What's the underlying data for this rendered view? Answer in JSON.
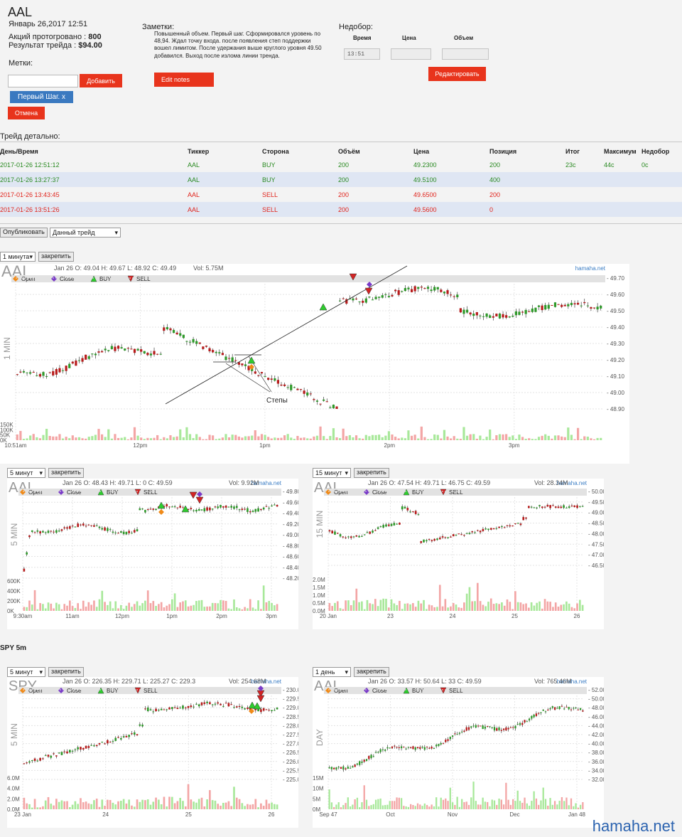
{
  "header": {
    "ticker": "AAL",
    "date": "Январь 26,2017 12:51",
    "shares_label": "Акций протогровано : ",
    "shares_value": "800",
    "result_label": "Результат трейда : ",
    "result_value": "$94.00"
  },
  "tags": {
    "label": "Метки:",
    "input_value": "",
    "add_button": "Добавить",
    "chip": "Первый Шаг.",
    "chip_close": "x",
    "cancel_button": "Отмена"
  },
  "notes": {
    "label": "Заметки:",
    "text": "Повышенный объем. Первый шаг. Сформировался уровень по 48,94. Ждал точку входа. после появления степ поддержки вошел лимитом. После удержания выше круглого уровня 49.50 добавился. Выход после излома линии тренда.",
    "button": "Edit notes"
  },
  "shortfall": {
    "label": "Недобор:",
    "col_time": "Время",
    "col_price": "Цена",
    "col_volume": "Объем",
    "time_value": "13:51",
    "price_value": "",
    "volume_value": "",
    "button": "Редактировать"
  },
  "details": {
    "label": "Трейд детально:",
    "columns": [
      "День/Время",
      "Тиккер",
      "Сторона",
      "Объём",
      "Цена",
      "Позиция",
      "Итог",
      "Максимум",
      "Недобор"
    ],
    "rows": [
      {
        "cells": [
          "2017-01-26 12:51:12",
          "AAL",
          "BUY",
          "200",
          "49.2300",
          "200",
          "23c",
          "44c",
          "0c"
        ],
        "side": "buy"
      },
      {
        "cells": [
          "2017-01-26 13:27:37",
          "AAL",
          "BUY",
          "200",
          "49.5100",
          "400",
          "",
          "",
          ""
        ],
        "side": "buy"
      },
      {
        "cells": [
          "2017-01-26 13:43:45",
          "AAL",
          "SELL",
          "200",
          "49.6500",
          "200",
          "",
          "",
          ""
        ],
        "side": "sell"
      },
      {
        "cells": [
          "2017-01-26 13:51:26",
          "AAL",
          "SELL",
          "200",
          "49.5600",
          "0",
          "",
          "",
          ""
        ],
        "side": "sell"
      }
    ]
  },
  "publish": {
    "button": "Опубликовать",
    "select": "Данный трейд"
  },
  "legend": {
    "open": "Open",
    "close": "Close",
    "buy": "BUY",
    "sell": "SELL"
  },
  "colors": {
    "up": "#2f9a2a",
    "down": "#b81c1c",
    "vol_up": "#a8e89a",
    "vol_down": "#f3a5a5",
    "open_marker": "#f08a18",
    "close_marker": "#7a3bc8",
    "buy_marker": "#2ecc2e",
    "sell_marker": "#d22424"
  },
  "spy_label": "SPY 5m",
  "charts": [
    {
      "id": "c1",
      "select": "1 минута",
      "pin": "закрепить",
      "symbol": "AAL",
      "side_label": "1 MIN",
      "brand": "hamaha.net",
      "ohlc": "Jan 26 O: 49.04 H: 49.67 L: 48.92 C: 49.49",
      "vol": "Vol: 5.75M",
      "yticks": [
        "49.70",
        "49.60",
        "49.50",
        "49.40",
        "49.30",
        "49.20",
        "49.10",
        "49.00",
        "48.90"
      ],
      "vticks": [
        "150K",
        "100K",
        "50K",
        "0K"
      ],
      "xticks": [
        "10:51am",
        "12pm",
        "1pm",
        "2pm",
        "3pm"
      ],
      "annotation": "Степы"
    },
    {
      "id": "c2",
      "select": "5 минут",
      "pin": "закрепить",
      "symbol": "AAL",
      "side_label": "5 MIN",
      "brand": "hamaha.net",
      "ohlc": "Jan 26 O: 48.43 H: 49.71 L: 0 C: 49.59",
      "vol": "Vol: 9.92M",
      "yticks": [
        "49.80",
        "49.60",
        "49.40",
        "49.20",
        "49.00",
        "48.80",
        "48.60",
        "48.40",
        "48.20"
      ],
      "vticks": [
        "600K",
        "400K",
        "200K",
        "0K"
      ],
      "xticks": [
        "9:30am",
        "11am",
        "12pm",
        "1pm",
        "2pm",
        "3pm"
      ]
    },
    {
      "id": "c3",
      "select": "15 минут",
      "pin": "закрепить",
      "symbol": "AAL",
      "side_label": "15 MIN",
      "brand": "hamaha.net",
      "ohlc": "Jan 26 O: 47.54 H: 49.71 L: 46.75 C: 49.59",
      "vol": "Vol: 28.34M",
      "yticks": [
        "50.00",
        "49.50",
        "49.00",
        "48.50",
        "48.00",
        "47.50",
        "47.00",
        "46.50"
      ],
      "vticks": [
        "2.0M",
        "1.5M",
        "1.0M",
        "0.5M",
        "0.0M"
      ],
      "xticks": [
        "20 Jan",
        "23",
        "24",
        "25",
        "26"
      ]
    },
    {
      "id": "c4",
      "select": "5 минут",
      "pin": "закрепить",
      "symbol": "SPY",
      "side_label": "5 MIN",
      "brand": "hamaha.net",
      "ohlc": "Jan 26 O: 226.35 H: 229.71 L: 225.27 C: 229.3",
      "vol": "Vol: 254.68M",
      "yticks": [
        "230.00",
        "229.50",
        "229.00",
        "228.50",
        "228.00",
        "227.50",
        "227.00",
        "226.50",
        "226.00",
        "225.50",
        "225.00"
      ],
      "vticks": [
        "6.0M",
        "4.0M",
        "2.0M",
        "0.0M"
      ],
      "xticks": [
        "23 Jan",
        "24",
        "25",
        "26"
      ]
    },
    {
      "id": "c5",
      "select": "1 день",
      "pin": "закрепить",
      "symbol": "AAL",
      "side_label": "DAY",
      "brand": "hamaha.net",
      "ohlc": "Jan 26 O: 33.57 H: 50.64 L: 33 C: 49.59",
      "vol": "Vol: 765.46M",
      "yticks": [
        "52.00",
        "50.00",
        "48.00",
        "46.00",
        "44.00",
        "42.00",
        "40.00",
        "38.00",
        "36.00",
        "34.00",
        "32.00"
      ],
      "vticks": [
        "15M",
        "10M",
        "5M",
        "0M"
      ],
      "xticks": [
        "Sep 47",
        "Oct",
        "Nov",
        "Dec",
        "Jan 48"
      ]
    }
  ],
  "watermark": "hamaha.net"
}
